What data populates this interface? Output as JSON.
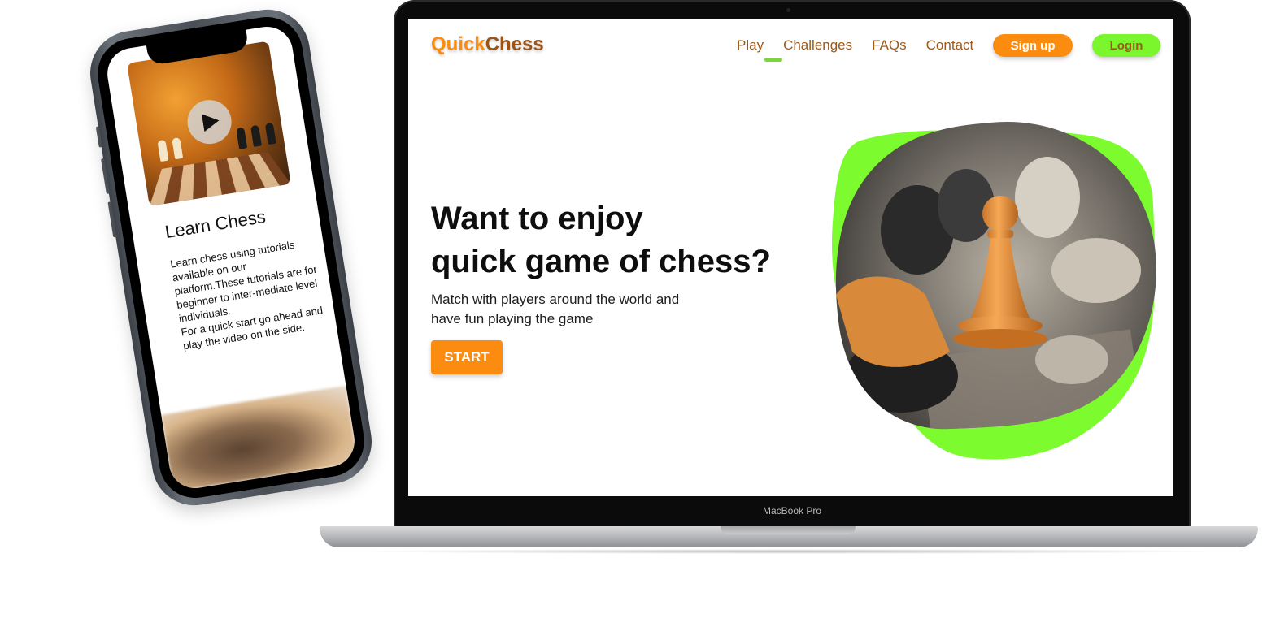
{
  "phone": {
    "card_title": "Learn Chess",
    "card_body": "Learn chess using tutorials available on our platform.These tutorials are for beginner to inter-mediate level individuals.\nFor a quick start go ahead and play the video on the side."
  },
  "laptop": {
    "label": "MacBook Pro"
  },
  "site": {
    "logo_part1": "Quick",
    "logo_part2": "Chess",
    "nav": [
      {
        "label": "Play",
        "active": true
      },
      {
        "label": "Challenges",
        "active": false
      },
      {
        "label": "FAQs",
        "active": false
      },
      {
        "label": "Contact",
        "active": false
      }
    ],
    "signup_label": "Sign up",
    "login_label": "Login",
    "hero_title_line1": "Want to enjoy",
    "hero_title_line2": "quick game of chess?",
    "hero_subtitle": "Match with players around the world and have fun playing the game",
    "start_label": "START"
  },
  "colors": {
    "brand_orange": "#fb8c10",
    "brand_brown": "#9b5317",
    "accent_green": "#7cf62c"
  }
}
